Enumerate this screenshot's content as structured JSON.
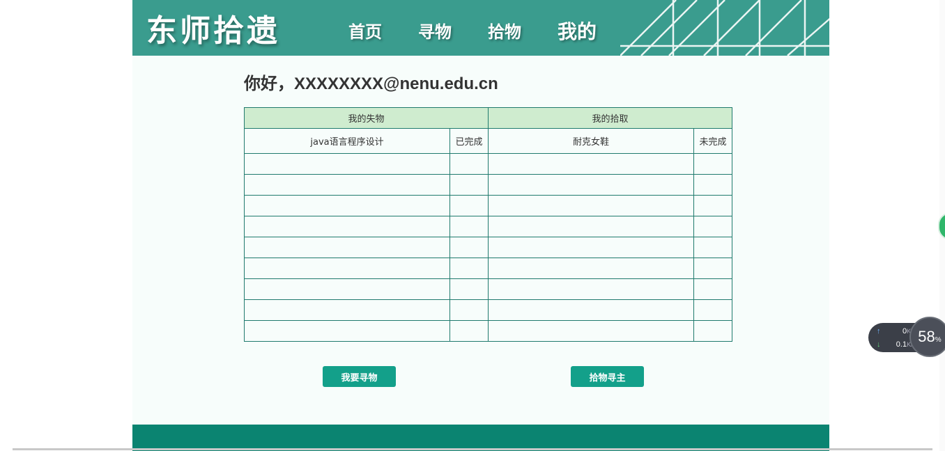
{
  "header": {
    "site_title": "东师拾遗",
    "nav": [
      "首页",
      "寻物",
      "拾物",
      "我的"
    ],
    "active_nav": "我的"
  },
  "greeting": "你好，XXXXXXXX@nenu.edu.cn",
  "table": {
    "headers": [
      "我的失物",
      "我的拾取"
    ],
    "lost": [
      {
        "name": "java语言程序设计",
        "status": "已完成"
      }
    ],
    "found": [
      {
        "name": "耐克女鞋",
        "status": "未完成"
      }
    ]
  },
  "buttons": {
    "find": "我要寻物",
    "return": "拾物寻主"
  },
  "speed_widget": {
    "up_value": "0",
    "up_unit": "K/s",
    "down_value": "0.1",
    "down_unit": "K/s",
    "cpu_value": "58",
    "cpu_unit": "%"
  },
  "colors": {
    "header_bg": "#3a9c8e",
    "table_header_bg": "#cfeccf",
    "button_bg": "#13a08a",
    "footer_bg": "#0b8471"
  }
}
